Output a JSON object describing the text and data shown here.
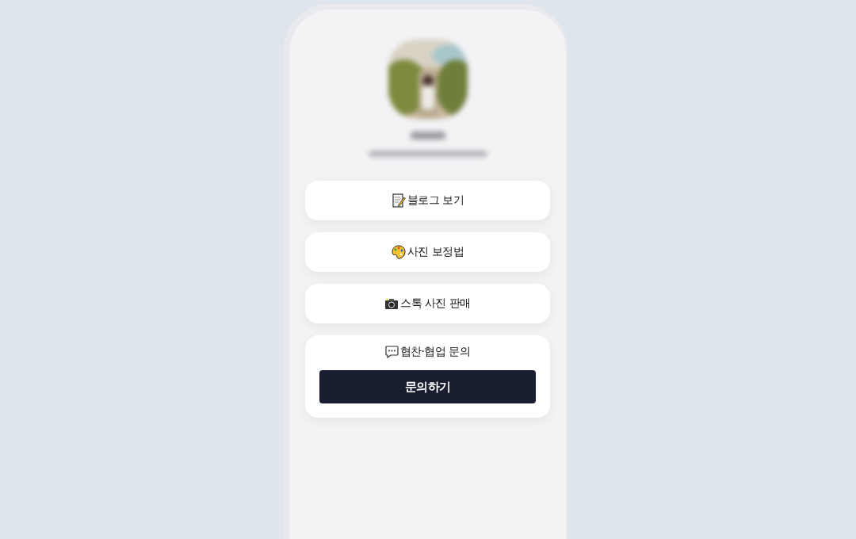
{
  "profile": {
    "name_blurred": true,
    "bio_blurred": true
  },
  "links": [
    {
      "label": "블로그 보기"
    },
    {
      "label": "사진 보정법"
    },
    {
      "label": "스톡 사진 판매"
    }
  ],
  "contact": {
    "label": "협찬·협업 문의",
    "button": "문의하기"
  }
}
